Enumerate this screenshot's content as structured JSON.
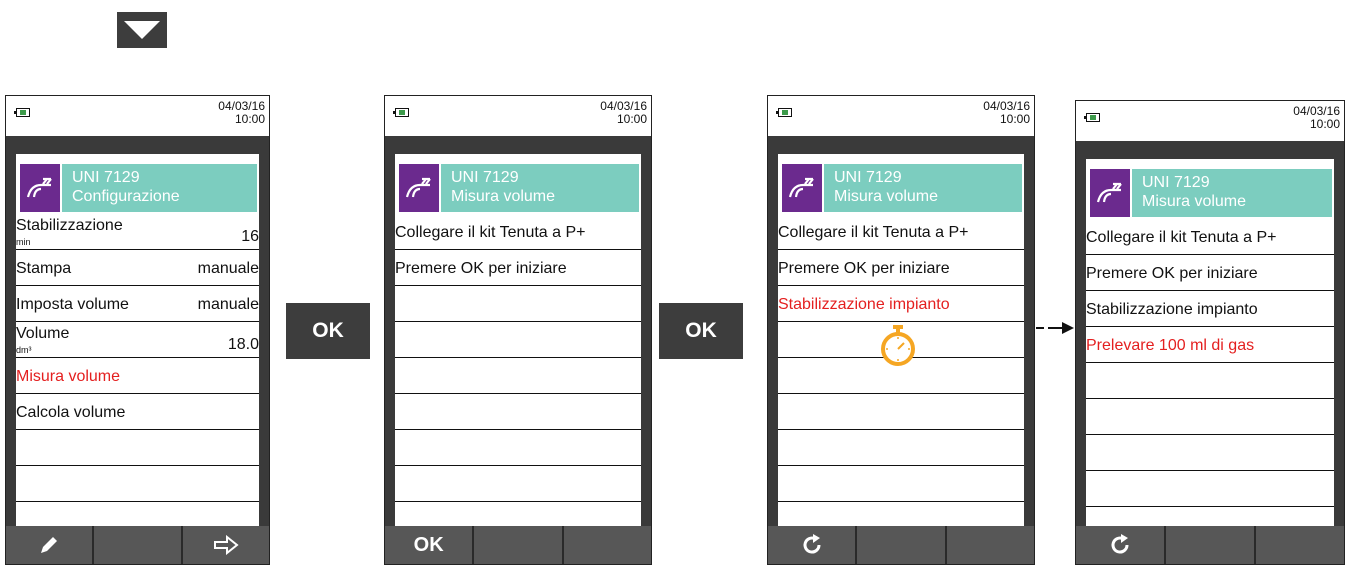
{
  "top_arrow_icon": "triangle-down-icon",
  "flow_buttons": [
    "OK",
    "OK"
  ],
  "devices": [
    {
      "date": "04/03/16",
      "time": "10:00",
      "title_line1": "UNI 7129",
      "title_line2": "Configurazione",
      "rows": [
        {
          "label": "Stabilizzazione",
          "unit": "min",
          "value": "16"
        },
        {
          "label": "Stampa",
          "value": "manuale"
        },
        {
          "label": "Imposta volume",
          "value": "manuale"
        },
        {
          "label": "Volume",
          "unit": "dm³",
          "value": "18.0"
        },
        {
          "label": "Misura volume"
        },
        {
          "label": "Calcola volume"
        }
      ],
      "softkeys": [
        "pencil-icon",
        "",
        "arrow-right-icon"
      ]
    },
    {
      "date": "04/03/16",
      "time": "10:00",
      "title_line1": "UNI 7129",
      "title_line2": "Misura volume",
      "rows": [
        {
          "label": "Collegare il kit Tenuta a P+"
        },
        {
          "label": "Premere OK per iniziare"
        }
      ],
      "softkeys": [
        "OK",
        "",
        ""
      ]
    },
    {
      "date": "04/03/16",
      "time": "10:00",
      "title_line1": "UNI 7129",
      "title_line2": "Misura volume",
      "rows": [
        {
          "label": "Collegare il kit Tenuta a P+"
        },
        {
          "label": "Premere OK per iniziare"
        },
        {
          "label": "Stabilizzazione impianto"
        }
      ],
      "softkeys": [
        "refresh-icon",
        "",
        ""
      ]
    },
    {
      "date": "04/03/16",
      "time": "10:00",
      "title_line1": "UNI 7129",
      "title_line2": "Misura volume",
      "rows": [
        {
          "label": "Collegare il kit Tenuta a P+"
        },
        {
          "label": "Premere OK per iniziare"
        },
        {
          "label": "Stabilizzazione impianto"
        },
        {
          "label": "Prelevare 100 ml di gas"
        }
      ],
      "softkeys": [
        "refresh-icon",
        "",
        ""
      ]
    }
  ],
  "colors": {
    "accent_teal": "#7ccdbf",
    "icon_purple": "#6b2a8e",
    "highlight_red": "#e41f1f",
    "timer_orange": "#f5a623",
    "device_frame": "#3a3a3a"
  }
}
